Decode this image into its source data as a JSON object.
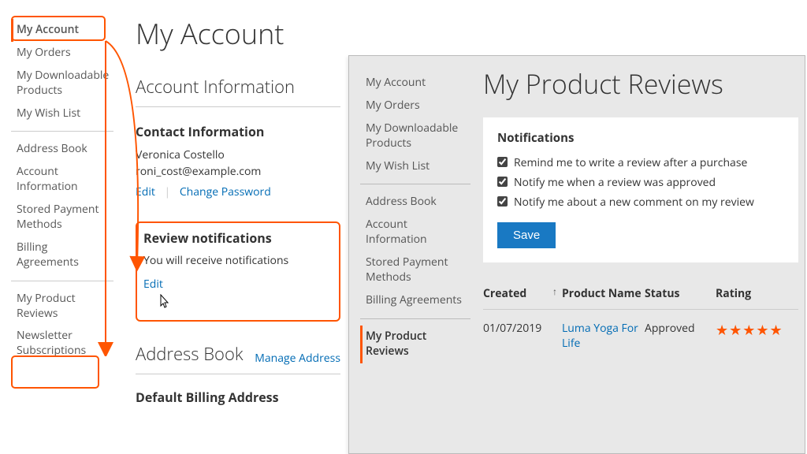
{
  "left": {
    "title": "My Account",
    "sidebar": {
      "g1": [
        {
          "label": "My Account",
          "active": true
        },
        {
          "label": "My Orders"
        },
        {
          "label": "My Downloadable Products"
        },
        {
          "label": "My Wish List"
        }
      ],
      "g2": [
        {
          "label": "Address Book"
        },
        {
          "label": "Account Information"
        },
        {
          "label": "Stored Payment Methods"
        },
        {
          "label": "Billing Agreements"
        }
      ],
      "g3": [
        {
          "label": "My Product Reviews"
        },
        {
          "label": "Newsletter Subscriptions"
        }
      ]
    },
    "section_account_info": "Account Information",
    "contact": {
      "heading": "Contact Information",
      "name": "Veronica Costello",
      "email": "roni_cost@example.com",
      "edit": "Edit",
      "change_password": "Change Password"
    },
    "review_notifications": {
      "heading": "Review notifications",
      "text": "You will receive notifications",
      "edit": "Edit"
    },
    "address_book": {
      "title": "Address Book",
      "manage": "Manage Address",
      "billing_heading": "Default Billing Address"
    }
  },
  "right": {
    "title": "My Product Reviews",
    "sidebar": {
      "g1": [
        {
          "label": "My Account"
        },
        {
          "label": "My Orders"
        },
        {
          "label": "My Downloadable Products"
        },
        {
          "label": "My Wish List"
        }
      ],
      "g2": [
        {
          "label": "Address Book"
        },
        {
          "label": "Account Information"
        },
        {
          "label": "Stored Payment Methods"
        },
        {
          "label": "Billing Agreements"
        }
      ],
      "g3": [
        {
          "label": "My Product Reviews",
          "active": true
        }
      ]
    },
    "notifications": {
      "title": "Notifications",
      "opts": [
        "Remind me to write a review after a purchase",
        "Notify me when a review was approved",
        "Notify me about a new comment on my review"
      ],
      "save": "Save"
    },
    "table": {
      "cols": {
        "created": "Created",
        "name": "Product Name",
        "status": "Status",
        "rating": "Rating"
      },
      "rows": [
        {
          "created": "01/07/2019",
          "name": "Luma Yoga For Life",
          "status": "Approved",
          "rating": 5
        }
      ]
    }
  }
}
